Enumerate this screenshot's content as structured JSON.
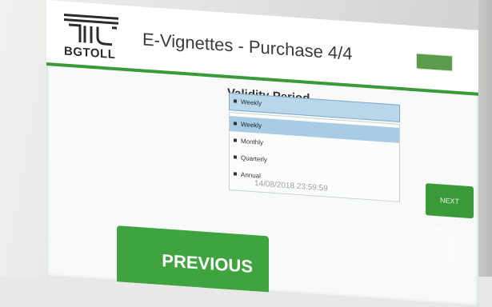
{
  "brand": {
    "name": "BGTOLL",
    "color": "#3a9a3a"
  },
  "header": {
    "title": "E-Vignettes - Purchase 4/4",
    "top_button_label": ""
  },
  "validity": {
    "label": "Validity Period",
    "selected_value": "Weekly",
    "options": [
      "Weekly",
      "Monthly",
      "Quarterly",
      "Annual"
    ],
    "highlighted_option": "Weekly"
  },
  "valid_until": "14/08/2018 23:59:59",
  "buttons": {
    "next": "NEXT",
    "previous": "PREVIOUS"
  },
  "icons": {
    "logo": "bgtoll-logo-icon",
    "dropdown_bullet": "square-bullet-icon",
    "watermark": "caduceus-icon"
  }
}
